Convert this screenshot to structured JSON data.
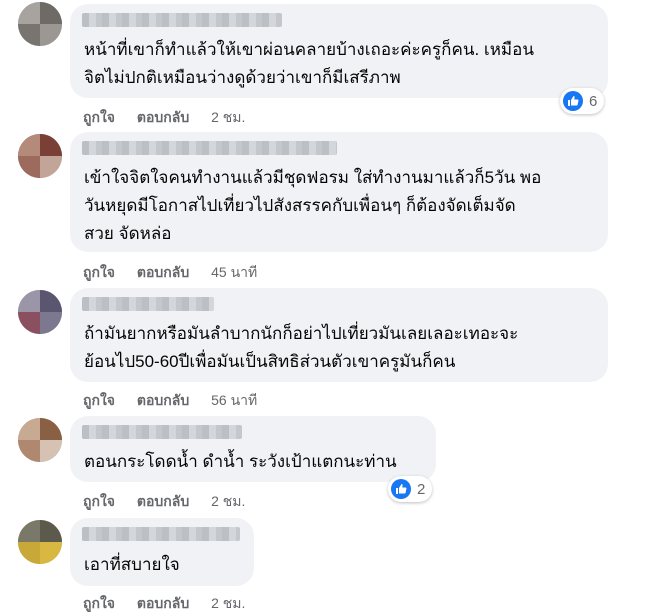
{
  "colors": {
    "bubble_bg": "#f0f2f5",
    "meta_text": "#65676b",
    "like_blue": "#1877f2"
  },
  "comments": [
    {
      "text": "หน้าที่เขาก็ทำแล้วให้เขาผ่อนคลายบ้างเถอะค่ะครูก็คน. เหมือน\nจิตไม่ปกติเหมือนว่างดูด้วยว่าเขาก็มีเสรีภาพ",
      "like_label": "ถูกใจ",
      "reply_label": "ตอบกลับ",
      "time": "2 ชม.",
      "reaction_icon": "like-icon",
      "reaction_count": "6"
    },
    {
      "text": "เข้าใจจิตใจคนทำงานแล้วมีชุดฟอรม ใส่ทำงานมาแล้วก็5วัน พอ\nวันหยุดมีโอกาสไปเที่ยวไปสังสรรคกับเพื่อนๆ ก็ต้องจัดเต็มจัด\nสวย จัดหล่อ",
      "like_label": "ถูกใจ",
      "reply_label": "ตอบกลับ",
      "time": "45 นาที"
    },
    {
      "text": "ถ้ามันยากหรือมันลำบากนักก็อย่าไปเที่ยวมันเลยเลอะเทอะจะ\nย้อนไป50-60ปีเพื่อมันเป็นสิทธิส่วนตัวเขาครูมันก็คน",
      "like_label": "ถูกใจ",
      "reply_label": "ตอบกลับ",
      "time": "56 นาที"
    },
    {
      "text": "ตอนกระโดดน้ำ ดำน้ำ ระวังเป้าแตกนะท่าน",
      "like_label": "ถูกใจ",
      "reply_label": "ตอบกลับ",
      "time": "2 ชม.",
      "reaction_icon": "like-icon",
      "reaction_count": "2"
    },
    {
      "text": "เอาที่สบายใจ",
      "like_label": "ถูกใจ",
      "reply_label": "ตอบกลับ",
      "time": "2 ชม."
    }
  ]
}
